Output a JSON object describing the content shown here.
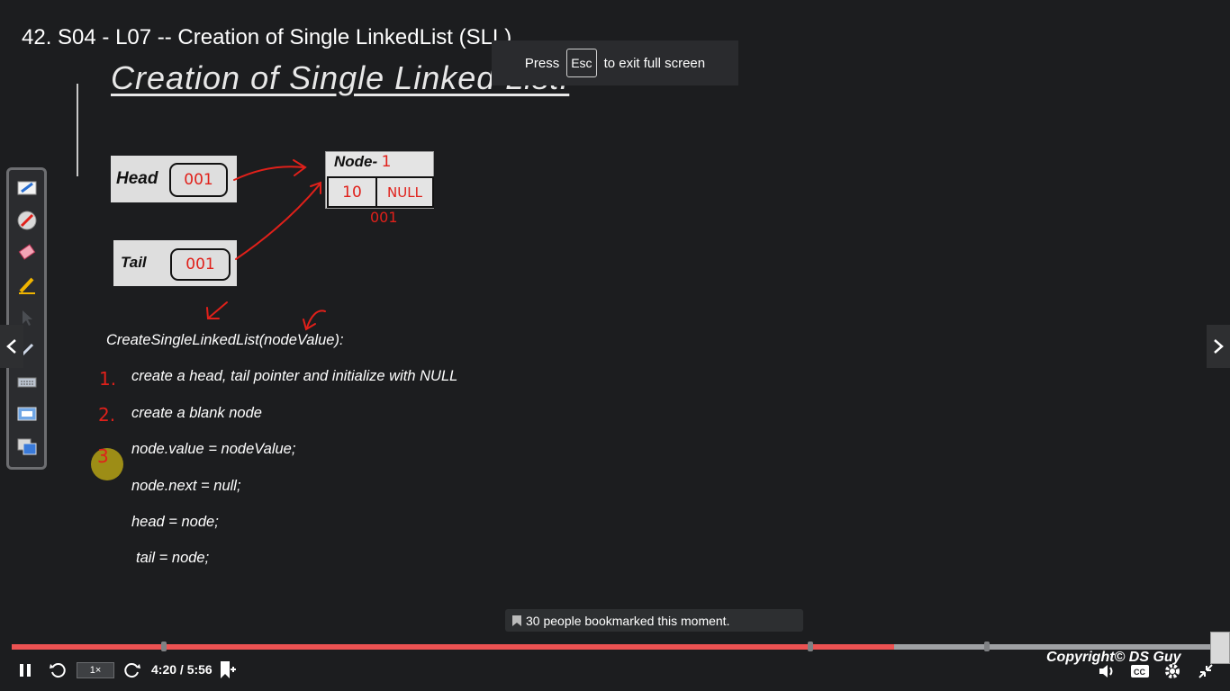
{
  "video": {
    "title": "42. S04 - L07 -- Creation of Single LinkedList (SLL)"
  },
  "fullscreen_toast": {
    "press": "Press",
    "key": "Esc",
    "rest": "to exit full screen"
  },
  "slide": {
    "title": "Creation of Single Linked List:",
    "diagram": {
      "head_label": "Head",
      "head_value": "001",
      "tail_label": "Tail",
      "tail_value": "001",
      "node_label": "Node-",
      "node_number": "1",
      "node_value": "10",
      "node_next": "NULL",
      "node_address": "001"
    },
    "algorithm": {
      "signature": "CreateSingleLinkedList(nodeValue):",
      "steps": [
        {
          "num": "1.",
          "text": "create a head, tail pointer and initialize with NULL"
        },
        {
          "num": "2.",
          "text": "create a blank node"
        },
        {
          "num": "3",
          "text": "node.value = nodeValue;"
        },
        {
          "num": "",
          "text": "node.next = null;"
        },
        {
          "num": "",
          "text": "head = node;"
        },
        {
          "num": "",
          "text": "tail = node;"
        }
      ]
    },
    "pen_tools": [
      "highlighter-icon",
      "pen-icon",
      "eraser-icon",
      "marker-icon",
      "pointer-icon",
      "brush-icon",
      "keyboard-icon",
      "screen-icon",
      "windows-icon"
    ]
  },
  "player": {
    "bookmark_text": "30 people bookmarked this moment.",
    "speed": "1×",
    "time": "4:20 / 5:56",
    "progress": 0.731,
    "chapter_markers": [
      0.126,
      0.662,
      0.808
    ],
    "copyright": "Copyright© DS Guy",
    "colors": {
      "progress": "#ec5252",
      "background": "#1c1d1f",
      "annotation_red": "#e0201a"
    }
  }
}
